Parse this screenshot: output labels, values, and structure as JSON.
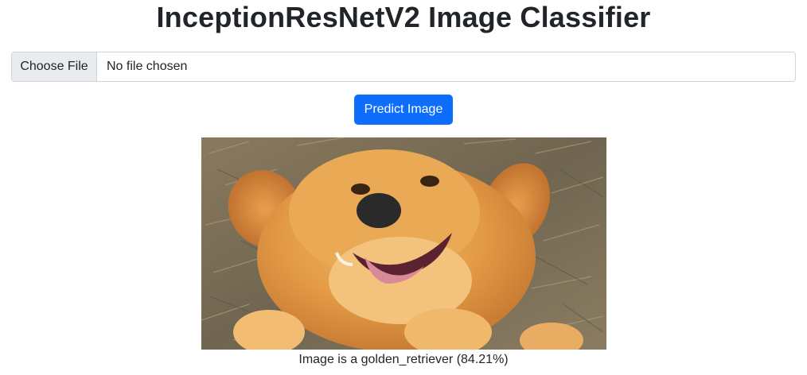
{
  "page": {
    "title": "InceptionResNetV2 Image Classifier"
  },
  "upload": {
    "choose_label": "Choose File",
    "status_text": "No file chosen"
  },
  "actions": {
    "predict_label": "Predict Image"
  },
  "result": {
    "caption": "Image is a golden_retriever (84.21%)"
  },
  "colors": {
    "primary": "#0d6efd",
    "text": "#212529",
    "input_border": "#ced4da",
    "file_button_bg": "#e9ecef"
  }
}
